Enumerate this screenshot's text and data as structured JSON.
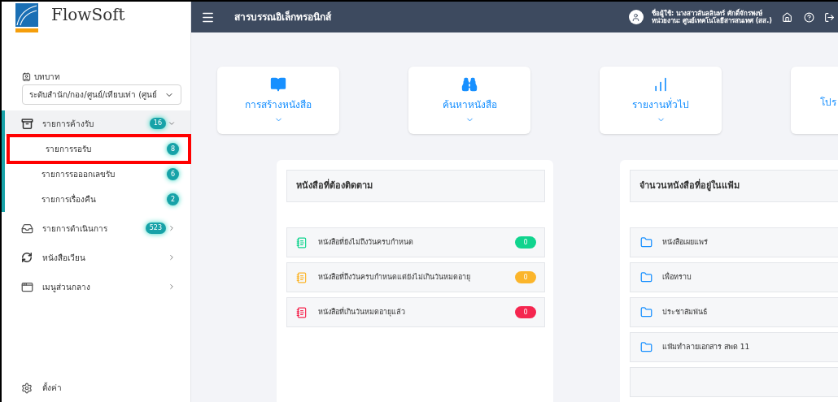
{
  "sidebar": {
    "logo": {
      "name": "FlowSoft"
    },
    "role_label": "บทบาท",
    "role_select": {
      "value": "ระดับสำนัก/กอง/ศูนย์/เทียบเท่า (ศูนย์"
    },
    "menu": [
      {
        "label": "รายการค้างรับ",
        "badge": "16",
        "expanded": true,
        "children": [
          {
            "label": "รายการรอรับ",
            "badge": "8",
            "highlighted": true
          },
          {
            "label": "รายการรอออกเลขรับ",
            "badge": "6",
            "highlighted": false
          },
          {
            "label": "รายการเรื่องคืน",
            "badge": "2",
            "highlighted": false
          }
        ]
      },
      {
        "label": "รายการดำเนินการ",
        "badge": "523",
        "expanded": false
      },
      {
        "label": "หนังสือเวียน",
        "expanded": false
      },
      {
        "label": "เมนูส่วนกลาง",
        "expanded": false
      }
    ],
    "settings": "ตั้งค่า"
  },
  "header": {
    "title": "สารบรรณอิเล็กทรอนิกส์",
    "user_line": "ชื่อผู้ใช้: นางสาวลันลลินทร์ ศักดิ์จักรพงษ์",
    "unit_line": "หน่วยงาน: ศูนย์เทคโนโลยีสารสนเทศ (สส.)"
  },
  "quick_cards": [
    {
      "label": "การสร้างหนังสือ",
      "kind": "full"
    },
    {
      "label": "ค้นหาหนังสือ",
      "kind": "full"
    },
    {
      "label": "รายงานทั่วไป",
      "kind": "full"
    },
    {
      "label": "โปร",
      "kind": "clipped"
    }
  ],
  "follow_panel": {
    "title": "หนังสือที่ต้องติดตาม",
    "items": [
      {
        "label": "หนังสือที่ยังไม่ถึงวันครบกำหนด",
        "count": "0",
        "color": "#10d48e"
      },
      {
        "label": "หนังสือที่ถึงวันครบกำหนดแต่ยังไม่เกินวันหมดอายุ",
        "count": "0",
        "color": "#fbb52b"
      },
      {
        "label": "หนังสือที่เกินวันหมดอายุแล้ว",
        "count": "0",
        "color": "#f5264f"
      }
    ]
  },
  "folder_panel": {
    "title": "จำนวนหนังสือที่อยู่ในแฟ้ม",
    "items": [
      "หนังสือเผยแพร่",
      "เพื่อทราบ",
      "ประชาสัมพันธ์",
      "แฟ้มทำลายเอกสาร สพด 11"
    ]
  }
}
